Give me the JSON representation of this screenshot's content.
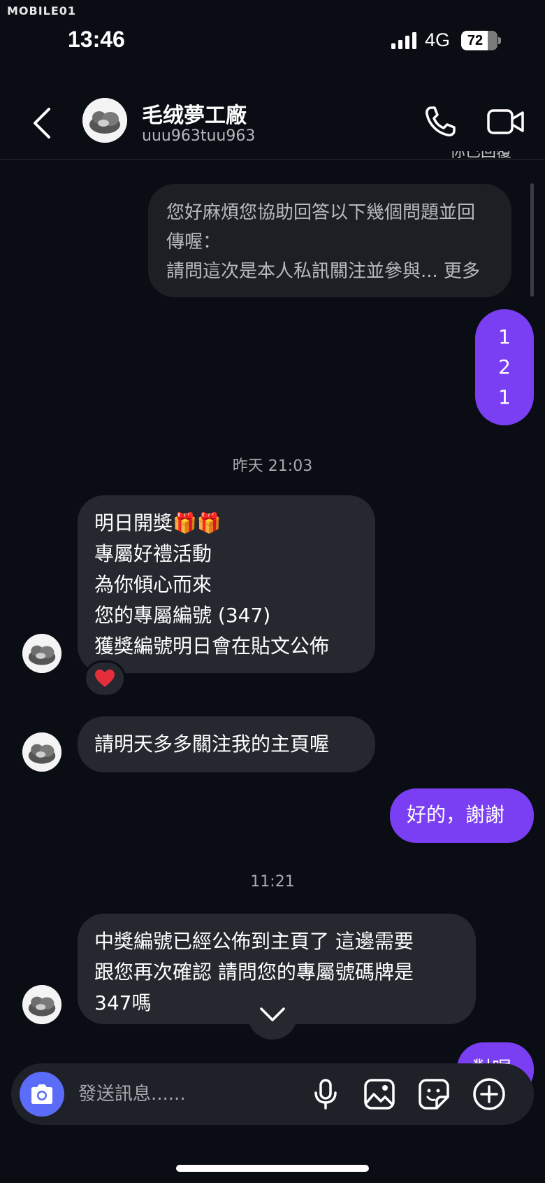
{
  "watermark": "MOBILE01",
  "status_bar": {
    "time": "13:46",
    "network": "4G",
    "battery": "72"
  },
  "header": {
    "name": "毛绒夢工廠",
    "handle": "uuu963tuu963"
  },
  "replied_label": "你已回覆",
  "quoted_message": {
    "line1": "您好麻煩您協助回答以下幾個問題並回",
    "line2": "傳喔：",
    "line3": "請問這次是本人私訊關注並參與... 更多"
  },
  "messages": {
    "out_121": [
      "1",
      "2",
      "1"
    ],
    "ts1": "昨天 21:03",
    "in1": [
      "明日開獎🎁🎁",
      "專屬好禮活動",
      "為你傾心而來",
      "您的專屬編號 (347)",
      "獲獎編號明日會在貼文公佈"
    ],
    "reaction": "❤️",
    "in2": "請明天多多關注我的主頁喔",
    "out2": "好的，謝謝",
    "ts2": "11:21",
    "in3": [
      "中獎編號已經公佈到主頁了  這邊需要",
      "跟您再次確認  請問您的專屬號碼牌是",
      "347嗎"
    ],
    "out3_partial": "對喔"
  },
  "composer": {
    "placeholder": "發送訊息......"
  },
  "colors": {
    "outgoing": "#7a3ff2",
    "incoming": "#26282f",
    "camera": "#5b6cf9"
  }
}
